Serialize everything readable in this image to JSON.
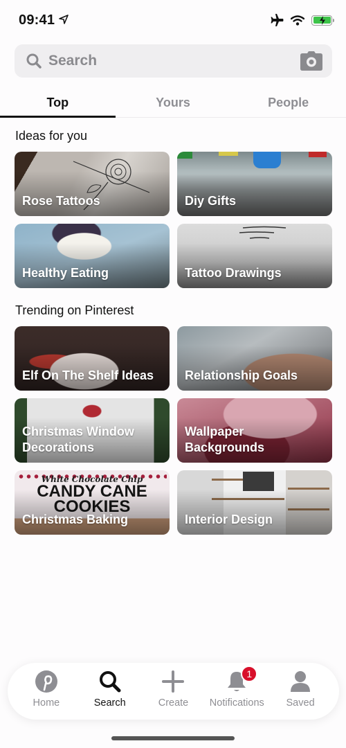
{
  "status_bar": {
    "time": "09:41",
    "icons": [
      "location-arrow-icon",
      "airplane-icon",
      "wifi-icon",
      "battery-charging-icon"
    ],
    "battery_color": "#3ec44a"
  },
  "search": {
    "placeholder": "Search",
    "icon": "search-icon",
    "camera_icon": "camera-icon"
  },
  "tabs": [
    {
      "label": "Top",
      "active": true
    },
    {
      "label": "Yours",
      "active": false
    },
    {
      "label": "People",
      "active": false
    }
  ],
  "sections": {
    "ideas": {
      "title": "Ideas for you",
      "tiles": [
        {
          "label": "Rose Tattoos"
        },
        {
          "label": "Diy Gifts"
        },
        {
          "label": "Healthy Eating"
        },
        {
          "label": "Tattoo Drawings"
        }
      ]
    },
    "trending": {
      "title": "Trending on Pinterest",
      "tiles": [
        {
          "label": "Elf On The Shelf Ideas"
        },
        {
          "label": "Relationship Goals"
        },
        {
          "label": "Christmas Window Decorations"
        },
        {
          "label": "Wallpaper Backgrounds"
        },
        {
          "label": "Christmas Baking",
          "image_text_top": "White Chocolate Chip",
          "image_text_main": "CANDY CANE COOKIES"
        },
        {
          "label": "Interior Design"
        }
      ]
    }
  },
  "bottom_nav": {
    "items": [
      {
        "label": "Home",
        "icon": "pinterest-logo-icon",
        "active": false
      },
      {
        "label": "Search",
        "icon": "search-icon",
        "active": true
      },
      {
        "label": "Create",
        "icon": "plus-icon",
        "active": false
      },
      {
        "label": "Notifications",
        "icon": "bell-icon",
        "active": false,
        "badge": "1"
      },
      {
        "label": "Saved",
        "icon": "person-icon",
        "active": false
      }
    ],
    "badge_color": "#d8102b"
  }
}
